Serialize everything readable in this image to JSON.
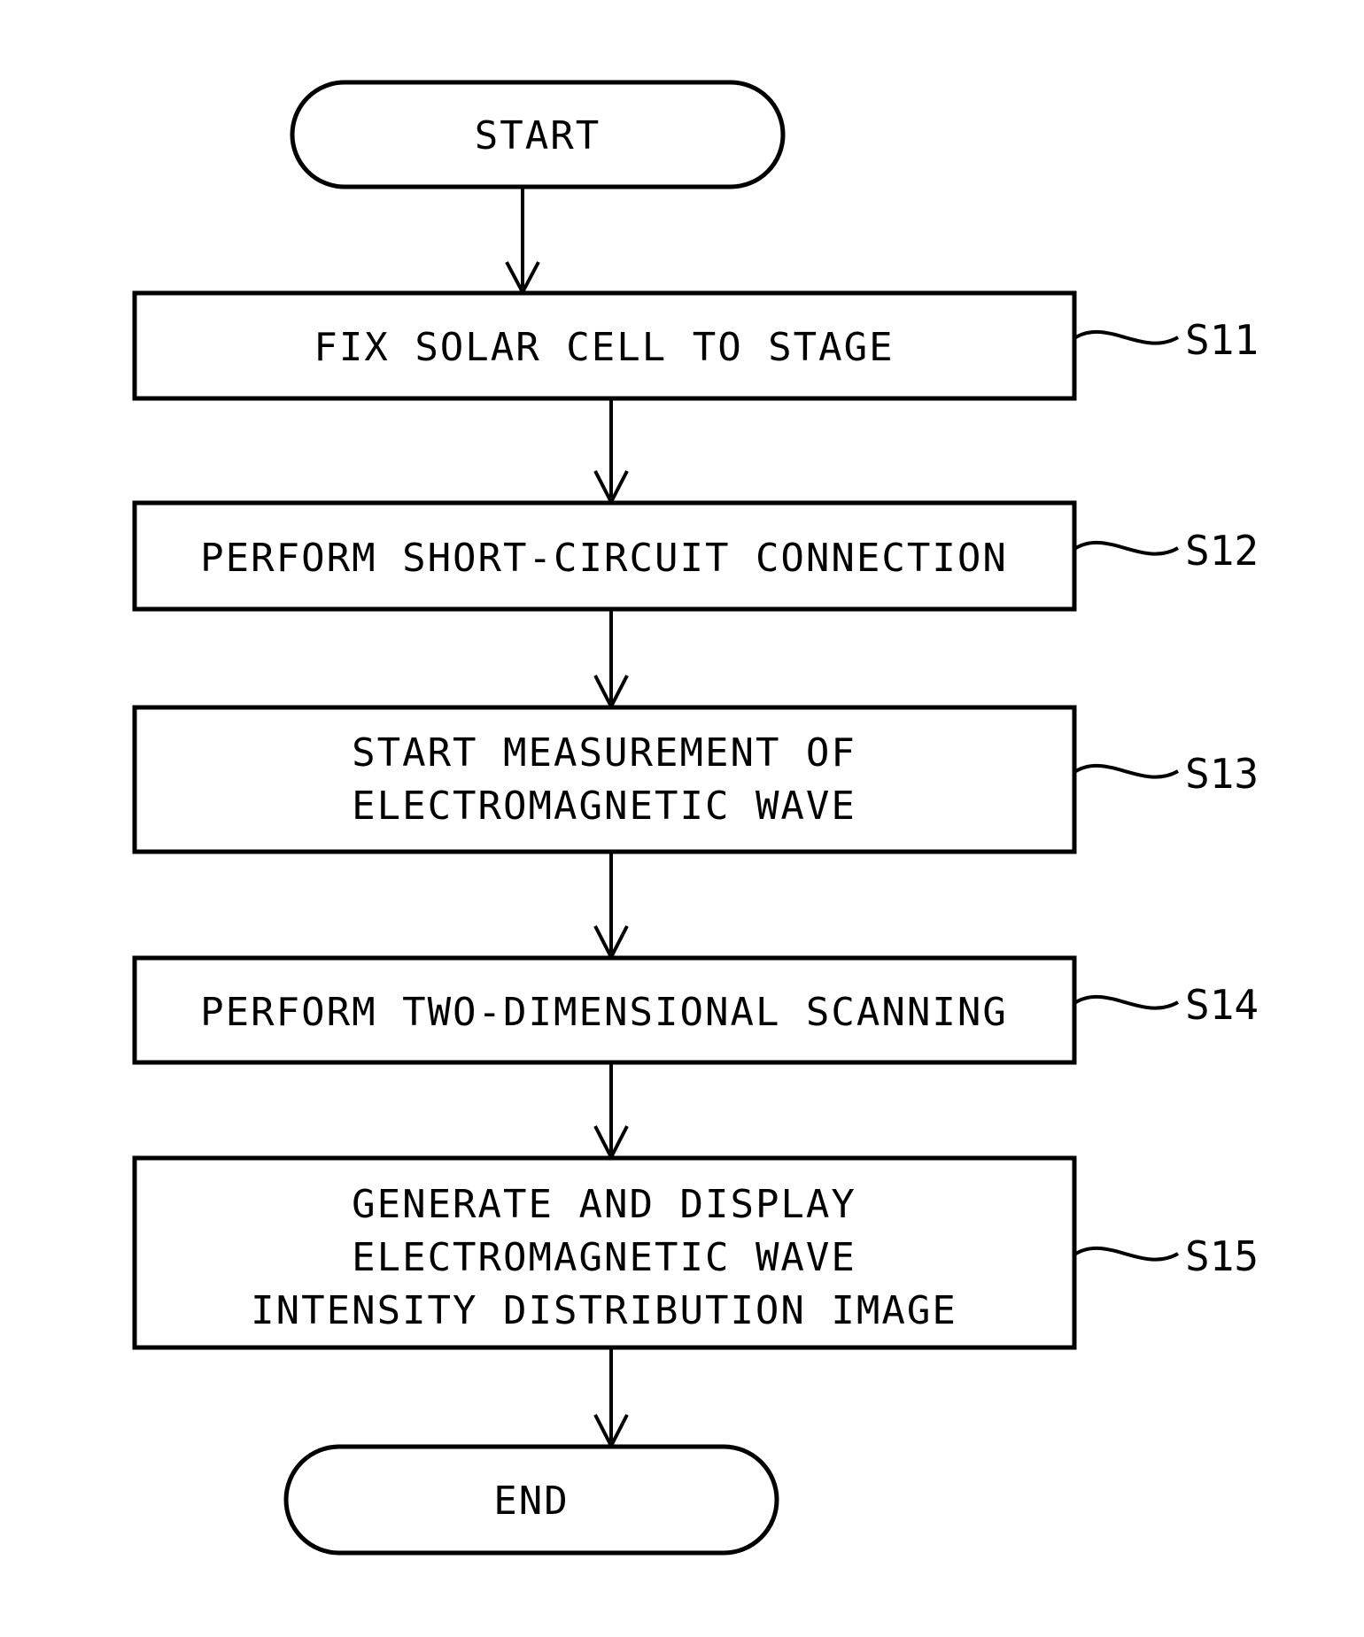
{
  "figure": {
    "type": "flowchart",
    "orientation": "vertical",
    "background_color": "#ffffff",
    "line_color": "#000000"
  },
  "nodes": {
    "start": {
      "shape": "terminator",
      "label": "START"
    },
    "s11": {
      "shape": "process",
      "ref": "S11",
      "lines": [
        "FIX SOLAR CELL TO STAGE"
      ]
    },
    "s12": {
      "shape": "process",
      "ref": "S12",
      "lines": [
        "PERFORM SHORT-CIRCUIT CONNECTION"
      ]
    },
    "s13": {
      "shape": "process",
      "ref": "S13",
      "lines": [
        "START MEASUREMENT OF",
        "ELECTROMAGNETIC WAVE"
      ]
    },
    "s14": {
      "shape": "process",
      "ref": "S14",
      "lines": [
        "PERFORM TWO-DIMENSIONAL SCANNING"
      ]
    },
    "s15": {
      "shape": "process",
      "ref": "S15",
      "lines": [
        "GENERATE AND DISPLAY",
        "ELECTROMAGNETIC WAVE",
        "INTENSITY DISTRIBUTION IMAGE"
      ]
    },
    "end": {
      "shape": "terminator",
      "label": "END"
    }
  },
  "edges": [
    {
      "from": "start",
      "to": "s11",
      "style": "arrow"
    },
    {
      "from": "s11",
      "to": "s12",
      "style": "arrow"
    },
    {
      "from": "s12",
      "to": "s13",
      "style": "arrow"
    },
    {
      "from": "s13",
      "to": "s14",
      "style": "arrow"
    },
    {
      "from": "s14",
      "to": "s15",
      "style": "arrow"
    },
    {
      "from": "s15",
      "to": "end",
      "style": "arrow"
    }
  ]
}
